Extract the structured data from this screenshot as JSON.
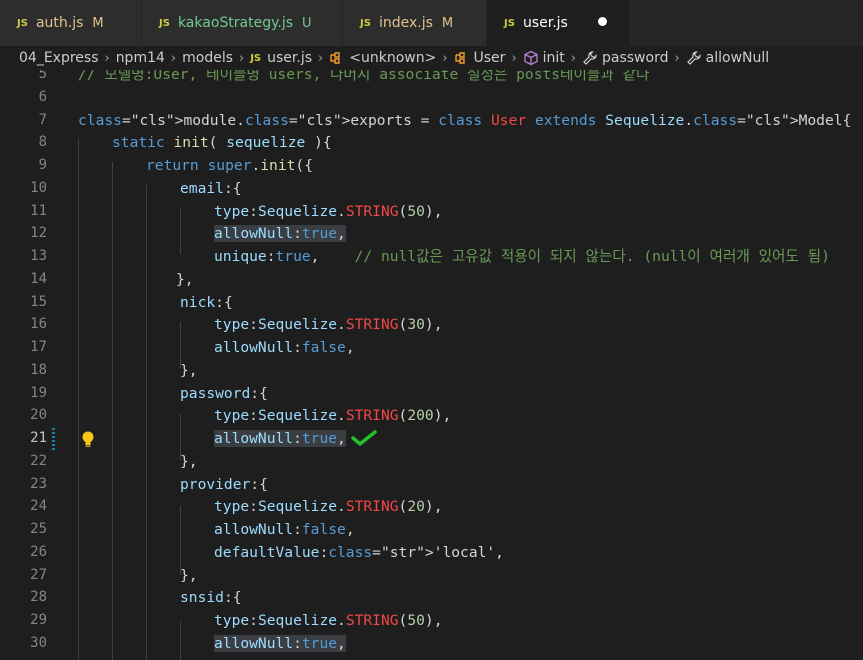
{
  "tabs": [
    {
      "badge": "JS",
      "label": "auth.js",
      "status": "M",
      "active": false
    },
    {
      "badge": "JS",
      "label": "kakaoStrategy.js",
      "status": "U",
      "active": false
    },
    {
      "badge": "JS",
      "label": "index.js",
      "status": "M",
      "active": false
    },
    {
      "badge": "JS",
      "label": "user.js",
      "status": "",
      "active": true,
      "unsaved": true
    }
  ],
  "breadcrumb": {
    "items": [
      "04_Express",
      "npm14",
      "models",
      "user.js",
      "<unknown>",
      "User",
      "init",
      "password",
      "allowNull"
    ],
    "file_badge": "JS"
  },
  "editor": {
    "lines": [
      {
        "n": "5",
        "text": "// 모델명:User, 테이블명 users, 나머지 associate 설정은 posts테이블과 같다"
      },
      {
        "n": "6",
        "text": ""
      },
      {
        "n": "7",
        "text": "module.exports = class User extends Sequelize.Model{"
      },
      {
        "n": "8",
        "text": "static init( sequelize ){"
      },
      {
        "n": "9",
        "text": "return super.init({"
      },
      {
        "n": "10",
        "text": "email:{"
      },
      {
        "n": "11",
        "text": "type:Sequelize.STRING(50),"
      },
      {
        "n": "12",
        "text": "allowNull:true,"
      },
      {
        "n": "13",
        "text": "unique:true,    // null값은 고유값 적용이 되지 않는다. (null이 여러개 있어도 됨)"
      },
      {
        "n": "14",
        "text": "},"
      },
      {
        "n": "15",
        "text": "nick:{"
      },
      {
        "n": "16",
        "text": "type:Sequelize.STRING(30),"
      },
      {
        "n": "17",
        "text": "allowNull:false,"
      },
      {
        "n": "18",
        "text": "},"
      },
      {
        "n": "19",
        "text": "password:{"
      },
      {
        "n": "20",
        "text": "type:Sequelize.STRING(200),"
      },
      {
        "n": "21",
        "text": "allowNull:true,"
      },
      {
        "n": "22",
        "text": "},"
      },
      {
        "n": "23",
        "text": "provider:{"
      },
      {
        "n": "24",
        "text": "type:Sequelize.STRING(20),"
      },
      {
        "n": "25",
        "text": "allowNull:false,"
      },
      {
        "n": "26",
        "text": "defaultValue:'local',"
      },
      {
        "n": "27",
        "text": "},"
      },
      {
        "n": "28",
        "text": "snsid:{"
      },
      {
        "n": "29",
        "text": "type:Sequelize.STRING(50),"
      },
      {
        "n": "30",
        "text": "allowNull:true,"
      }
    ],
    "current_line": "21"
  },
  "colors": {
    "keyword": "#569cd6",
    "class_red": "#f44747",
    "string": "#ce9178",
    "number": "#b5cea8",
    "comment": "#6a9955",
    "check_mark": "#22c12a",
    "bulb": "#f5c518"
  },
  "icons": [
    "lightbulb-icon",
    "green-check-icon",
    "cube-icon",
    "wrench-icon",
    "symbol-class-icon"
  ]
}
